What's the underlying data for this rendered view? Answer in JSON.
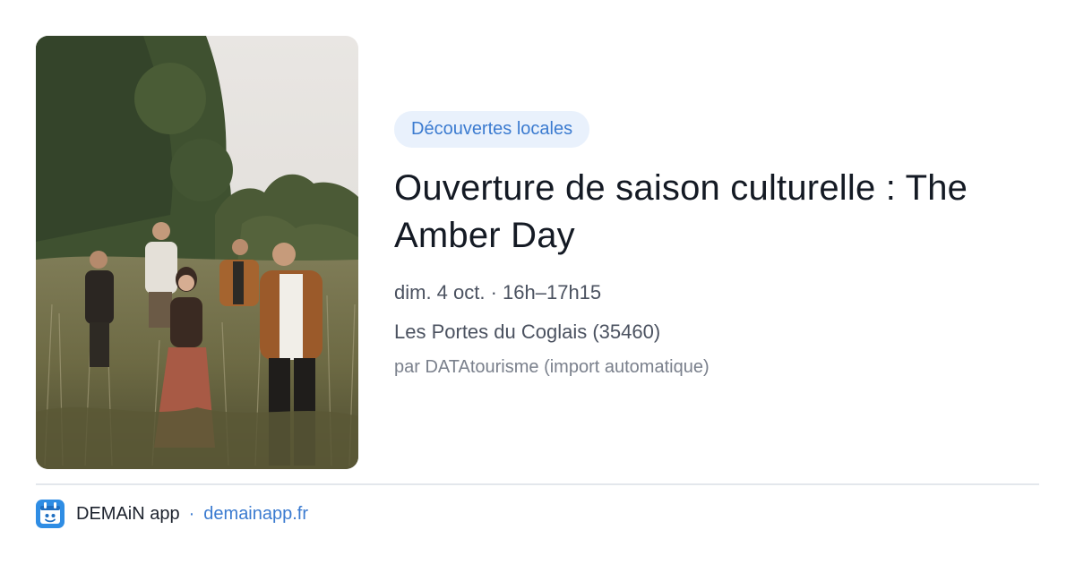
{
  "card": {
    "photo_alt": "Photo du groupe The Amber Day",
    "category": "Découvertes locales",
    "title": "Ouverture de saison culturelle : The Amber Day",
    "datetime": "dim. 4 oct. · 16h–17h15",
    "location": "Les Portes du Coglais (35460)",
    "source": "par DATAtourisme (import automatique)"
  },
  "footer": {
    "app_icon": "demain-app-icon",
    "app_name": "DEMAiN app",
    "separator": "·",
    "site": "demainapp.fr"
  },
  "colors": {
    "accent": "#3b7bd0",
    "tag_bg": "#e9f1fc",
    "title": "#141a24",
    "body_text": "#4b5260",
    "muted_text": "#7a808c",
    "divider": "#e3e7ec"
  }
}
